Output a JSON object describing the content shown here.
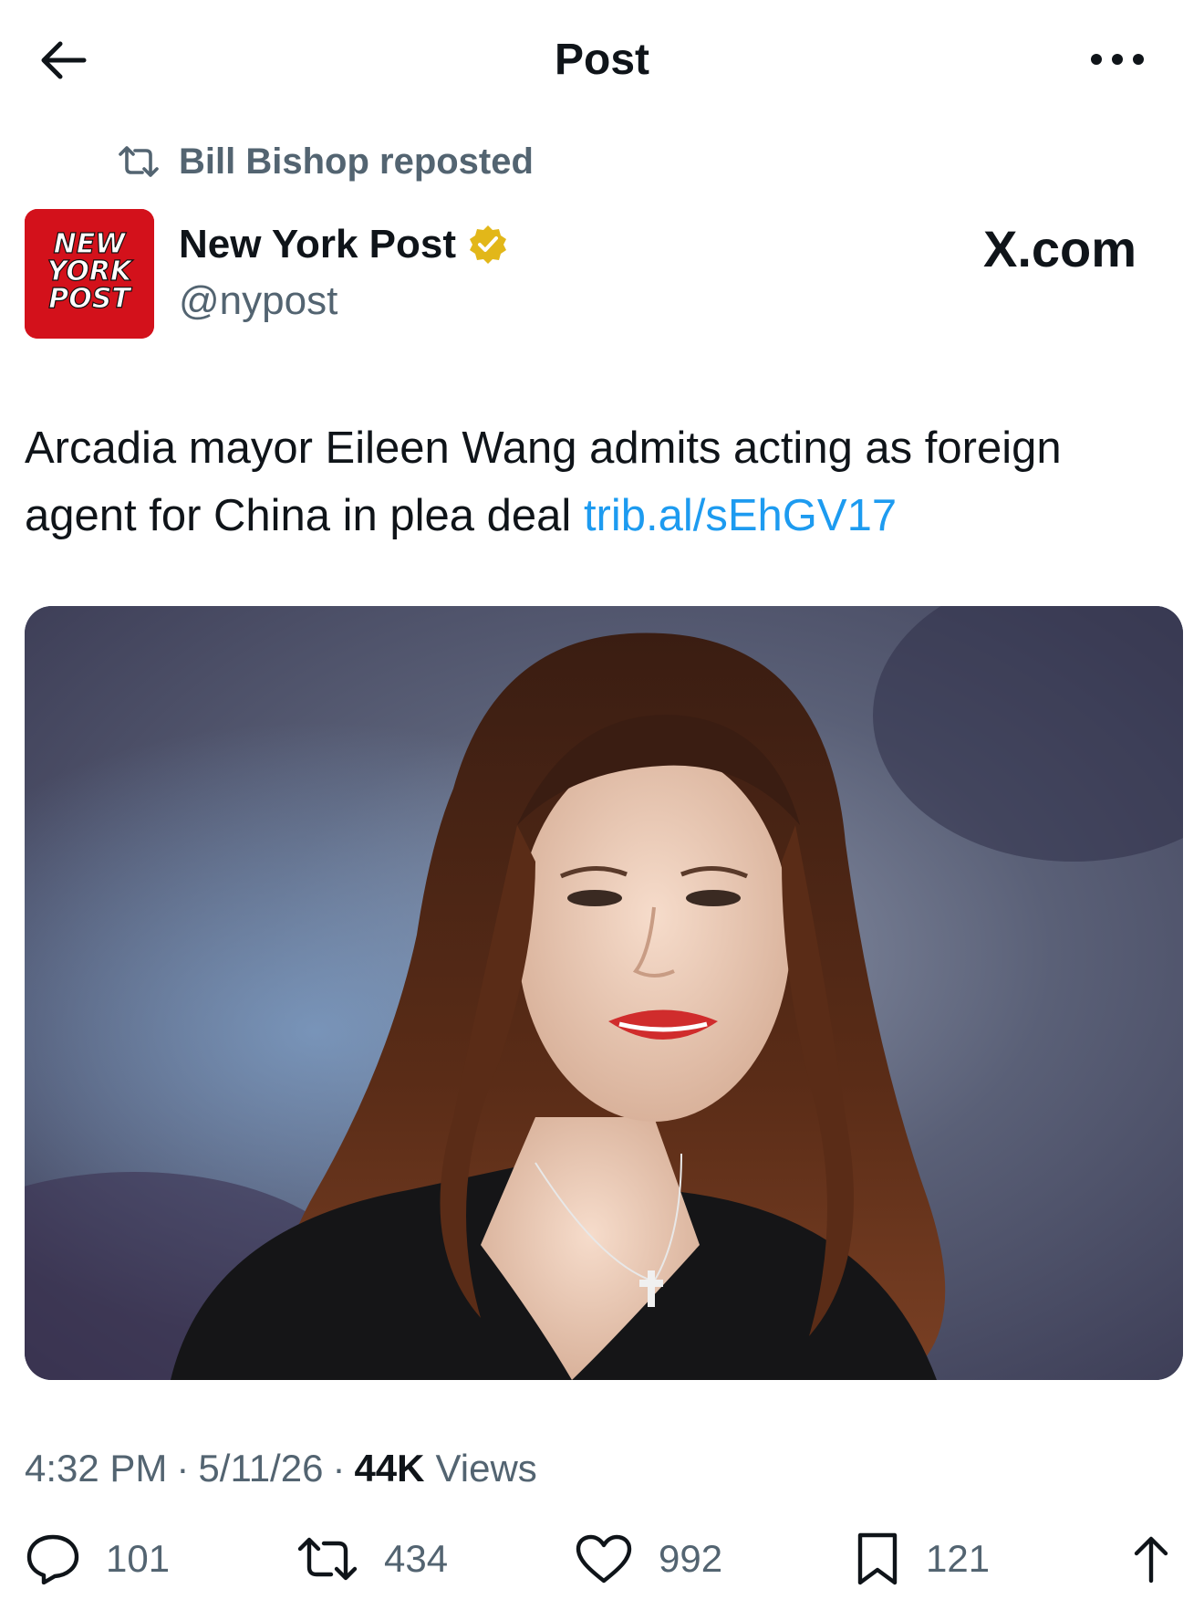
{
  "header": {
    "title": "Post",
    "back_icon": "arrow-left-icon",
    "more_icon": "more-horizontal-icon"
  },
  "repost": {
    "label": "Bill Bishop reposted",
    "icon": "repost-icon"
  },
  "author": {
    "name": "New York Post",
    "handle": "@nypost",
    "avatar_lines": [
      "NEW",
      "YORK",
      "POST"
    ],
    "avatar_color": "#d3111b",
    "verified_color": "#e2b719"
  },
  "source_label": "X.com",
  "post": {
    "text": "Arcadia mayor Eileen Wang admits acting as foreign agent for China in plea deal ",
    "link": "trib.al/sEhGV17",
    "link_color": "#1d9bf0"
  },
  "meta": {
    "time": "4:32 PM",
    "date": "5/11/26",
    "separator": "·",
    "views_count": "44K",
    "views_label": "Views"
  },
  "actions": {
    "replies": "101",
    "reposts": "434",
    "likes": "992",
    "bookmarks": "121",
    "icons": [
      "reply-icon",
      "repost-icon",
      "like-icon",
      "bookmark-icon",
      "share-icon"
    ]
  }
}
